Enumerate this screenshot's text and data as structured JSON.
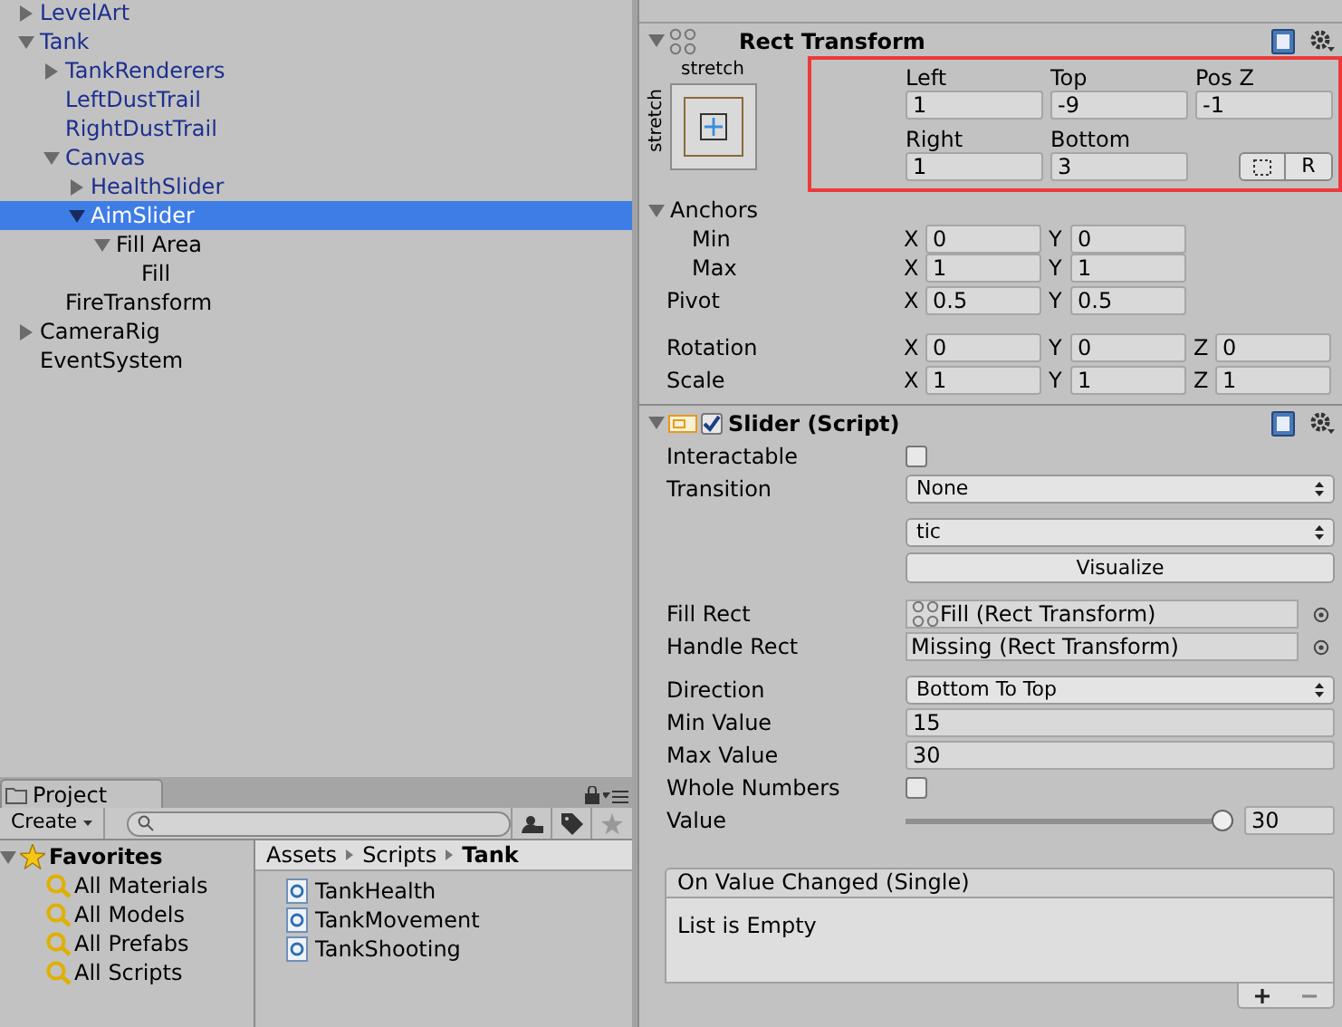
{
  "hierarchy": [
    {
      "label": "LevelArt",
      "prefab": true,
      "selected": false,
      "expanded": false
    },
    {
      "label": "Tank",
      "prefab": true,
      "selected": false,
      "expanded": true,
      "children": [
        {
          "label": "TankRenderers",
          "prefab": true,
          "selected": false,
          "expanded": false
        },
        {
          "label": "LeftDustTrail",
          "prefab": true,
          "selected": false
        },
        {
          "label": "RightDustTrail",
          "prefab": true,
          "selected": false
        },
        {
          "label": "Canvas",
          "prefab": true,
          "selected": false,
          "expanded": true,
          "children": [
            {
              "label": "HealthSlider",
              "prefab": true,
              "selected": false,
              "expanded": false
            },
            {
              "label": "AimSlider",
              "prefab": false,
              "selected": true,
              "expanded": true,
              "children": [
                {
                  "label": "Fill Area",
                  "prefab": false,
                  "selected": false,
                  "expanded": true,
                  "children": [
                    {
                      "label": "Fill",
                      "prefab": false,
                      "selected": false
                    }
                  ]
                }
              ]
            }
          ]
        },
        {
          "label": "FireTransform",
          "prefab": false,
          "selected": false
        }
      ]
    },
    {
      "label": "CameraRig",
      "prefab": false,
      "selected": false,
      "expanded": false
    },
    {
      "label": "EventSystem",
      "prefab": false,
      "selected": false
    }
  ],
  "project": {
    "tab": "Project",
    "create": "Create",
    "favorites": {
      "label": "Favorites",
      "expanded": true,
      "items": [
        "All Materials",
        "All Models",
        "All Prefabs",
        "All Scripts"
      ]
    },
    "breadcrumb": [
      "Assets",
      "Scripts",
      "Tank"
    ],
    "files": [
      "TankHealth",
      "TankMovement",
      "TankShooting"
    ]
  },
  "inspector": {
    "rect_transform": {
      "title": "Rect Transform",
      "expanded": true,
      "preset_h": "stretch",
      "preset_v": "stretch",
      "offsets": [
        {
          "label": "Left",
          "value": "1"
        },
        {
          "label": "Top",
          "value": "-9"
        },
        {
          "label": "Pos Z",
          "value": "-1"
        },
        {
          "label": "Right",
          "value": "1"
        },
        {
          "label": "Bottom",
          "value": "3"
        }
      ],
      "raw_button": "R",
      "anchors": {
        "label": "Anchors",
        "expanded": true,
        "rows": [
          {
            "label": "Min",
            "fields": [
              {
                "axis": "X",
                "value": "0"
              },
              {
                "axis": "Y",
                "value": "0"
              }
            ]
          },
          {
            "label": "Max",
            "fields": [
              {
                "axis": "X",
                "value": "1"
              },
              {
                "axis": "Y",
                "value": "1"
              }
            ]
          }
        ]
      },
      "pivot": {
        "label": "Pivot",
        "fields": [
          {
            "axis": "X",
            "value": "0.5"
          },
          {
            "axis": "Y",
            "value": "0.5"
          }
        ]
      },
      "transform": [
        {
          "label": "Rotation",
          "fields": [
            {
              "axis": "X",
              "value": "0"
            },
            {
              "axis": "Y",
              "value": "0"
            },
            {
              "axis": "Z",
              "value": "0"
            }
          ]
        },
        {
          "label": "Scale",
          "fields": [
            {
              "axis": "X",
              "value": "1"
            },
            {
              "axis": "Y",
              "value": "1"
            },
            {
              "axis": "Z",
              "value": "1"
            }
          ]
        }
      ]
    },
    "slider": {
      "title": "Slider (Script)",
      "expanded": true,
      "enabled": true,
      "groups": [
        [
          {
            "kind": "checkbox",
            "label": "Interactable",
            "checked": false
          },
          {
            "kind": "dropdown",
            "label": "Transition",
            "value": "None"
          }
        ],
        [
          {
            "kind": "dropdown",
            "value": "tic"
          },
          {
            "kind": "button",
            "value": "Visualize"
          }
        ],
        [
          {
            "kind": "object",
            "label": "Fill Rect",
            "value": "Fill (Rect Transform)",
            "icon": true
          },
          {
            "kind": "object",
            "label": "Handle Rect",
            "value": "Missing (Rect Transform)",
            "icon": false
          }
        ],
        [
          {
            "kind": "dropdown",
            "label": "Direction",
            "value": "Bottom To Top"
          },
          {
            "kind": "number",
            "label": "Min Value",
            "value": "15"
          },
          {
            "kind": "number",
            "label": "Max Value",
            "value": "30"
          },
          {
            "kind": "checkbox",
            "label": "Whole Numbers",
            "checked": false
          },
          {
            "kind": "slider",
            "label": "Value",
            "level": 1,
            "value": "30"
          }
        ]
      ],
      "event": {
        "title": "On Value Changed (Single)",
        "empty": "List is Empty"
      }
    }
  }
}
